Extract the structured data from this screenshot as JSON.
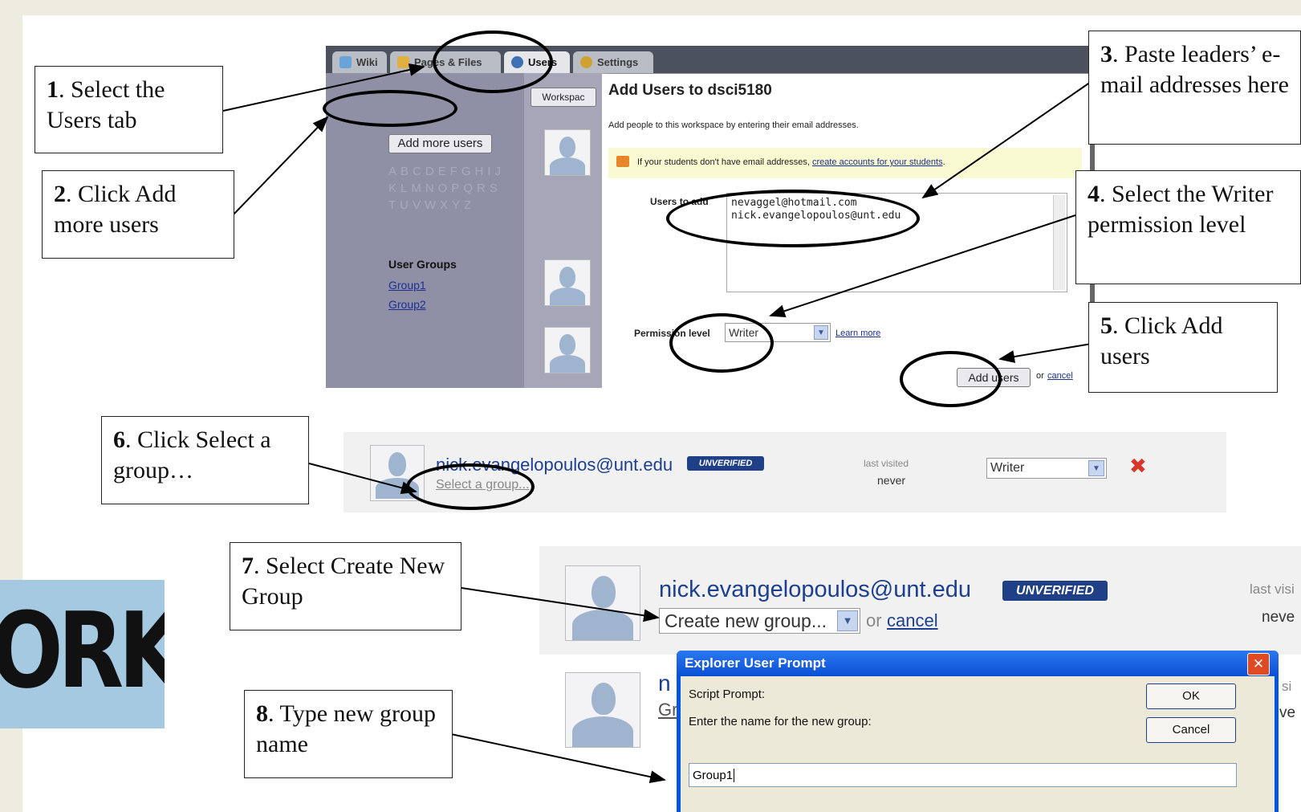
{
  "callouts": {
    "c1": {
      "num": "1",
      "text": ". Select the Users tab"
    },
    "c2": {
      "num": "2",
      "text": ". Click Add more users"
    },
    "c3": {
      "num": "3",
      "text": ". Paste leaders’ e-mail addresses here"
    },
    "c4": {
      "num": "4",
      "text": ". Select the Writer permission level"
    },
    "c5": {
      "num": "5",
      "text": ". Click Add users"
    },
    "c6": {
      "num": "6",
      "text": ". Click Select a group…"
    },
    "c7": {
      "num": "7",
      "text": ". Select Create New Group"
    },
    "c8": {
      "num": "8",
      "text": ". Type new group name"
    }
  },
  "tabs": [
    {
      "label": "Wiki",
      "icon": "wiki-icon",
      "color": "#6aa3d8"
    },
    {
      "label": "Pages & Files",
      "icon": "pages-files-icon",
      "color": "#e0b040"
    },
    {
      "label": "Users",
      "icon": "users-icon",
      "color": "#3f6fb5"
    },
    {
      "label": "Settings",
      "icon": "gear-icon",
      "color": "#d0a030"
    }
  ],
  "left_pane": {
    "add_more_users": "Add more users",
    "workspace_btn": "Workspac",
    "alphabet": [
      "ABCDEFGHIJ",
      "KLMNOPQRS",
      "TUVWXYZ"
    ],
    "user_groups_label": "User Groups",
    "groups": [
      "Group1",
      "Group2"
    ]
  },
  "dialog": {
    "title": "Add Users to dsci5180",
    "intro": "Add people to this workspace by entering their email addresses.",
    "note_prefix": "If your students don't have email addresses,",
    "note_link": "create accounts for your students",
    "note_suffix": ".",
    "users_label": "Users to add",
    "users_value": "nevaggel@hotmail.com\nnick.evangelopoulos@unt.edu",
    "permission_label": "Permission level",
    "permission_value": "Writer",
    "learn_more": "Learn more",
    "add_button": "Add users",
    "or": "or",
    "cancel": "cancel"
  },
  "row6": {
    "email": "nick.evangelopoulos@unt.edu",
    "badge": "UNVERIFIED",
    "select_group": "Select a group...",
    "last_visited_label": "last visited",
    "last_visited_value": "never",
    "permission": "Writer"
  },
  "row7": {
    "email": "nick.evangelopoulos@unt.edu",
    "badge": "UNVERIFIED",
    "group_select": "Create new group...",
    "or": "or",
    "cancel": "cancel",
    "last_visited_label": "last visi",
    "last_visited_value": "neve"
  },
  "row8": {
    "email_fragment": "n",
    "group_fragment": "Gr",
    "side_fragment_1": "si",
    "side_fragment_2": "ve"
  },
  "prompt": {
    "title": "Explorer User Prompt",
    "script_label": "Script Prompt:",
    "message": "Enter the name for the new group:",
    "ok": "OK",
    "cancel": "Cancel",
    "input_value": "Group1"
  },
  "logo_text": "ORKS"
}
